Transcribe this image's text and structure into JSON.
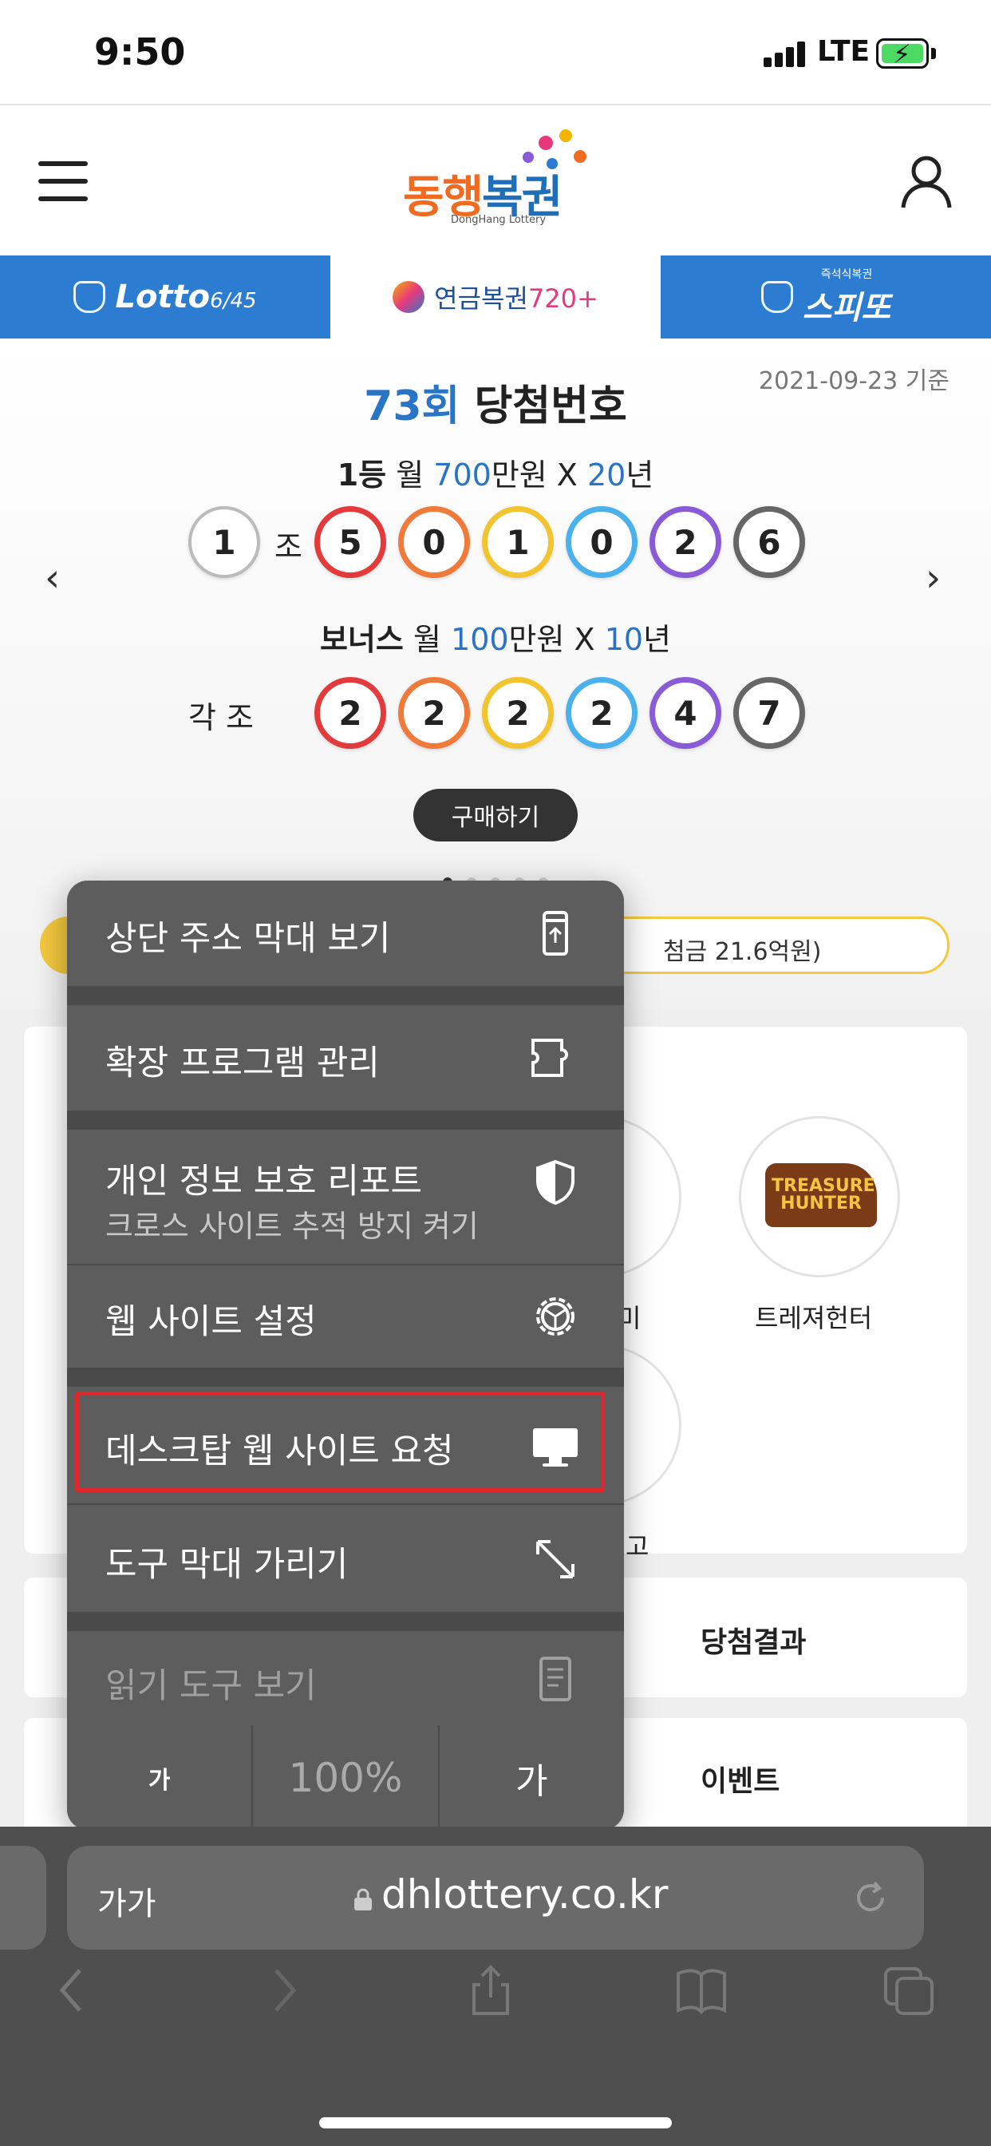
{
  "status_bar": {
    "time": "9:50",
    "network": "LTE"
  },
  "header": {
    "logo_main_a": "동행",
    "logo_main_b": "복권",
    "logo_sub": "DongHang Lottery"
  },
  "tabs": [
    {
      "label": "Lotto",
      "suffix": "6/45"
    },
    {
      "label_a": "연금복권",
      "label_b": "720",
      "plus": "+"
    },
    {
      "pre": "즉석식복권",
      "label": "스피또"
    }
  ],
  "draw": {
    "date": "2021-09-23 기준",
    "round": "73회",
    "title": "당첨번호",
    "first_prize": {
      "rank": "1등",
      "month_label": "월",
      "amount": "700",
      "unit": "만원 X",
      "years": "20",
      "years_unit": "년"
    },
    "first_group_number": "1",
    "first_group_label": "조",
    "first_numbers": [
      "5",
      "0",
      "1",
      "0",
      "2",
      "6"
    ],
    "bonus": {
      "rank": "보너스",
      "month_label": "월",
      "amount": "100",
      "unit": "만원 X",
      "years": "10",
      "years_unit": "년"
    },
    "bonus_group_label": "각 조",
    "bonus_numbers": [
      "2",
      "2",
      "2",
      "2",
      "4",
      "7"
    ],
    "buy_label": "구매하기",
    "prev_arrow": "‹",
    "next_arrow": "›",
    "notice_text": "첨금 21.6억원)"
  },
  "ball_colors": [
    "#e33b3b",
    "#ef7a3a",
    "#f2c530",
    "#4ab1ec",
    "#8a5bd6",
    "#666666"
  ],
  "games": [
    {
      "label": "트레져헌터",
      "art_text": "TREASURE HUNTER"
    },
    {
      "label": "미"
    },
    {
      "label": "고"
    }
  ],
  "sections": {
    "results_label": "당첨결과",
    "events_label": "이벤트"
  },
  "menu": {
    "items": [
      {
        "label": "상단 주소 막대 보기",
        "icon": "phone-top-bar-icon"
      },
      {
        "label": "확장 프로그램 관리",
        "icon": "puzzle-icon"
      },
      {
        "label": "개인 정보 보호 리포트",
        "sublabel": "크로스 사이트 추적 방지 켜기",
        "icon": "shield-icon"
      },
      {
        "label": "웹 사이트 설정",
        "icon": "gear-icon"
      },
      {
        "label": "데스크탑 웹 사이트 요청",
        "icon": "desktop-icon"
      },
      {
        "label": "도구 막대 가리기",
        "icon": "expand-arrows-icon"
      },
      {
        "label": "읽기 도구 보기",
        "icon": "reader-icon"
      }
    ],
    "font_small": "가",
    "zoom": "100%",
    "font_large": "가"
  },
  "browser": {
    "aa_label": "가가",
    "url": "dhlottery.co.kr"
  },
  "accent": {
    "highlight": "#e0262a",
    "lotto_blue": "#2c7dd1",
    "notice_yellow": "#f3c93f"
  }
}
